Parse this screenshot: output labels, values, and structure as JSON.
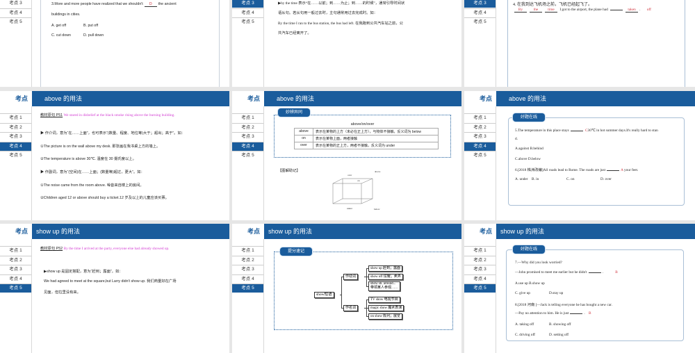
{
  "colors": {
    "accent": "#1a5c9c",
    "answer_red": "#d0303a",
    "quote_pink": "#d23cd2"
  },
  "sidebar_header": "考点",
  "sidebar_items": [
    "考点 1",
    "考点 2",
    "考点 3",
    "考点 4",
    "考点 5"
  ],
  "r1c1": {
    "q_line1": "3.More and more people have realized that we shouldn't",
    "answer": "D",
    "q_line1_end": "the ancient",
    "q_line2": "buildings in cities.",
    "opt_a": "A. get off",
    "opt_b": "B. put off",
    "opt_c": "C. cut down",
    "opt_d": "D. pull down"
  },
  "r1c2": {
    "lines": [
      "▶by the time 表示“在……以前；到……为止；到……的时候”，通常引导时间状",
      "语从句。若从句用一般过去时，主句通常用过去完成时。如：",
      "By the time I ran to the bus station, the bus had left. 在我跑到公共汽车站之前，公",
      "共汽车已经离开了。"
    ]
  },
  "r1c3": {
    "q": "4. 在我到达飞机场之前，飞机已经起飞了。",
    "a1": "By",
    "a2": "the",
    "a3": "time",
    "mid": "I got to the airport, the plane had",
    "a5": "taken",
    "a6": "off"
  },
  "above": {
    "title": "above  的用法"
  },
  "r2c1": {
    "src_label": "教材原句 P51",
    "src_quote": "We stared in disbelief at the black smoke rising above the burning building.",
    "lines": [
      "▶ 作介词，意为“在……上面”，也可表示“(数量、程度、地位等)大于；超出；高于”。如：",
      "①The picture is on the wall above my desk. 那张画在我书桌上方的墙上。",
      "②The temperature is above 30℃. 温度在 30 摄氏度以上。",
      "▶ 作副词，意为“(空间)在……上面；(数量等)超过，更大”。如：",
      "①The noise came from the room above. 噪音来自楼上的房间。",
      "②Children aged 12 or above should buy a ticket.12 岁及以上的儿童应该买票。"
    ]
  },
  "r2c2": {
    "tab": "妙辨异同",
    "table_title": "above/on/over",
    "rows": [
      {
        "word": "above",
        "desc": "表示在某物的上方（未必在正上方），与物体不接触，反义词为 below"
      },
      {
        "word": "on",
        "desc": "表示在某物上面，两者接触"
      },
      {
        "word": "over",
        "desc": "表示在某物的正上方，两者不接触，反义词为 under"
      }
    ],
    "mnemonic": "【图解助记】",
    "labels": {
      "over": "over",
      "on": "on",
      "above": "above",
      "under": "under",
      "below": "below"
    }
  },
  "r2c3": {
    "tab": "好题在线",
    "q5": "5.The temperature in this place stays",
    "q5_end": "30℃ in hot summer days.It's really hard to stan",
    "q5_line2": "d.",
    "q5_answer": "C",
    "q5_ab": "A.against  B.behind",
    "q5_cd": "C.above    D.below",
    "q6": "6.[2018 株洲改编]All roads lead to Rome. The roads are just",
    "q6_end": "your feet.",
    "q6_answer": "A",
    "q6_a": "A. under",
    "q6_b": "B. in",
    "q6_c": "C. on",
    "q6_d": "D. over"
  },
  "showup": {
    "title": "show up  的用法"
  },
  "r3c1": {
    "src_label": "教材原句 P52",
    "src_quote": "By the time I arrived at the party, everyone else had already showed up.",
    "lines": [
      "▶show up 是固定搭配，意为“赶到；露面”。如：",
      "We had agreed to meet at the square,but Larry didn't show up. 我们商量好在广场",
      "见面，但拉里没有来。"
    ]
  },
  "r3c2": {
    "tab": "提分速记",
    "root": "show短语",
    "verb": "作动词",
    "noun": "作名词",
    "verb_items": [
      "show up 赶到；露面",
      "show off 炫耀；卖弄",
      "show sb. around...",
      "带领某人参观……"
    ],
    "noun_items": [
      "TV show 电视节目",
      "magic show 魔术表演",
      "on show 陈列；展览"
    ]
  },
  "r3c3": {
    "tab": "好题在线",
    "q7": "7.—Why did you look worried?",
    "q7_line2": "—John promised to meet me earlier but he didn't",
    "q7_answer": "B",
    "q7_ab": "A.use up  B.show up",
    "q7_c": "C. give up",
    "q7_d": "D.stay up",
    "q8": "8.[2018 河南 ]—Jack is telling everyone he has bought a new car.",
    "q8_line2": "—Pay no attention to him. He is just",
    "q8_answer": "B",
    "q8_a": "A. taking off",
    "q8_b": "B. showing off",
    "q8_c": "C. driving off",
    "q8_d": "D. setting off"
  }
}
